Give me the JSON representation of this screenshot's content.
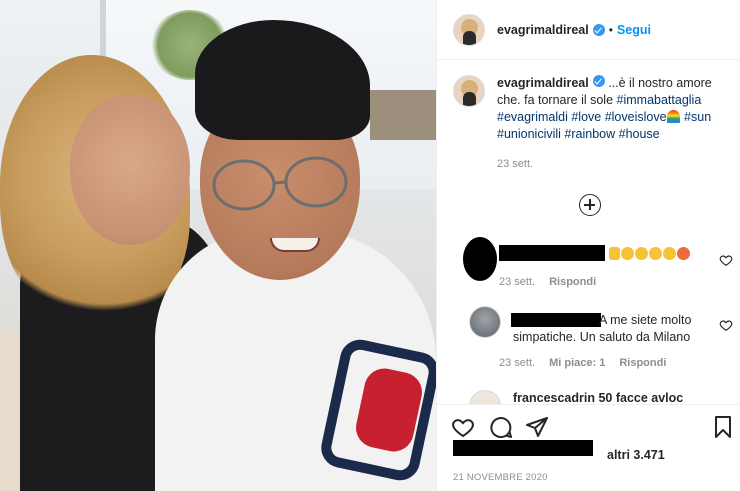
{
  "post": {
    "header": {
      "username": "evagrimaldireal",
      "separator": "•",
      "follow_label": "Segui"
    },
    "caption": {
      "username": "evagrimaldireal",
      "text_1": "...è il nostro amore che. fa tornare il sole ",
      "tags_1": "#immabattaglia",
      "tags_2": "#evagrimaldi",
      "tags_3": " #love",
      "tags_4": " #loveislove",
      "tags_5": "#sun",
      "tags_6": " #unionicivili",
      "tags_7": " #rainbow",
      "tags_8": " #house",
      "date": "23 sett."
    },
    "comments": [
      {
        "date": "23 sett.",
        "reply_label": "Rispondi"
      },
      {
        "text": "A me siete molto simpatiche. Un saluto da Milano",
        "date": "23 sett.",
        "likes_label": "Mi piace: 1",
        "reply_label": "Rispondi"
      },
      {
        "text": "francescadrin 50 facce avloc"
      }
    ],
    "likes": {
      "others_label": "altri 3.471"
    },
    "date": "21 NOVEMBRE 2020",
    "colors": {
      "link_blue": "#0095f6",
      "hashtag": "#00376b",
      "muted": "#8e8e8e",
      "verified": "#3897f0"
    },
    "icons": [
      "heart-icon",
      "comment-icon",
      "share-icon",
      "bookmark-icon",
      "plus-circle-icon",
      "verified-icon"
    ]
  }
}
